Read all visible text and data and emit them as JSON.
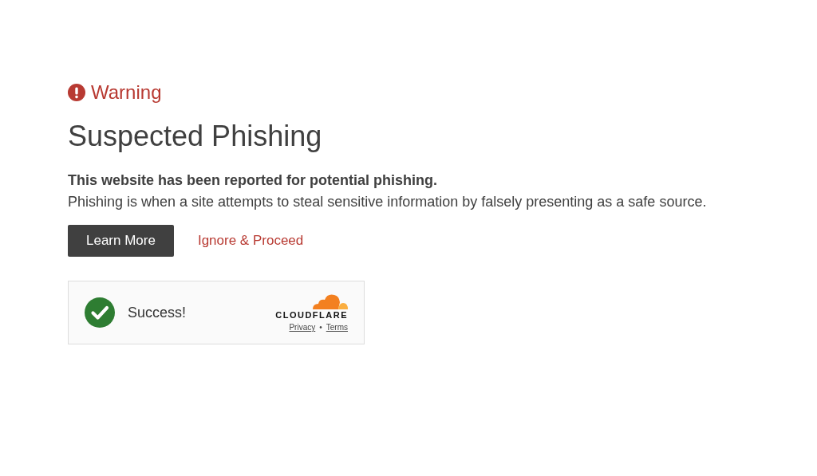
{
  "warning": {
    "label": "Warning"
  },
  "title": "Suspected Phishing",
  "lead": "This website has been reported for potential phishing.",
  "description": "Phishing is when a site attempts to steal sensitive information by falsely presenting as a safe source.",
  "buttons": [
    {
      "label": "Learn More",
      "kind": "primary"
    },
    {
      "label": "Ignore & Proceed",
      "kind": "link"
    }
  ],
  "widget": {
    "status": "Success!",
    "brand": "CLOUDFLARE",
    "links": [
      "Privacy",
      "Terms"
    ],
    "separator": "•"
  }
}
